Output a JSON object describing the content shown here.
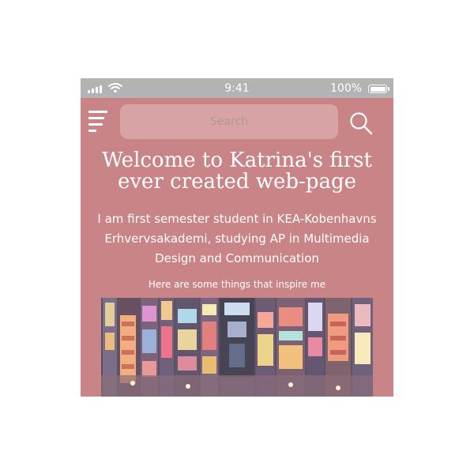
{
  "status_bar": {
    "time": "9:41",
    "battery_percent": "100%",
    "signal_icon": "cellular-signal-icon",
    "wifi_icon": "wifi-icon",
    "battery_icon": "battery-icon"
  },
  "header": {
    "menu_icon": "hamburger-menu-icon",
    "search_placeholder": "Search",
    "search_icon": "magnifier-icon"
  },
  "main": {
    "title": "Welcome to Katrina's first ever created web-page",
    "intro": "I am first semester student in KEA-Kobenhavns Erhvervsakademi, studying AP in Multimedia Design and Communication",
    "inspire_caption": "Here are some things that inspire me",
    "image_description": "night city street with neon signs"
  },
  "colors": {
    "background": "#c88486",
    "status_bar": "#b3b3b3",
    "search_field": "#d7a3a5",
    "text": "#ffffff"
  }
}
